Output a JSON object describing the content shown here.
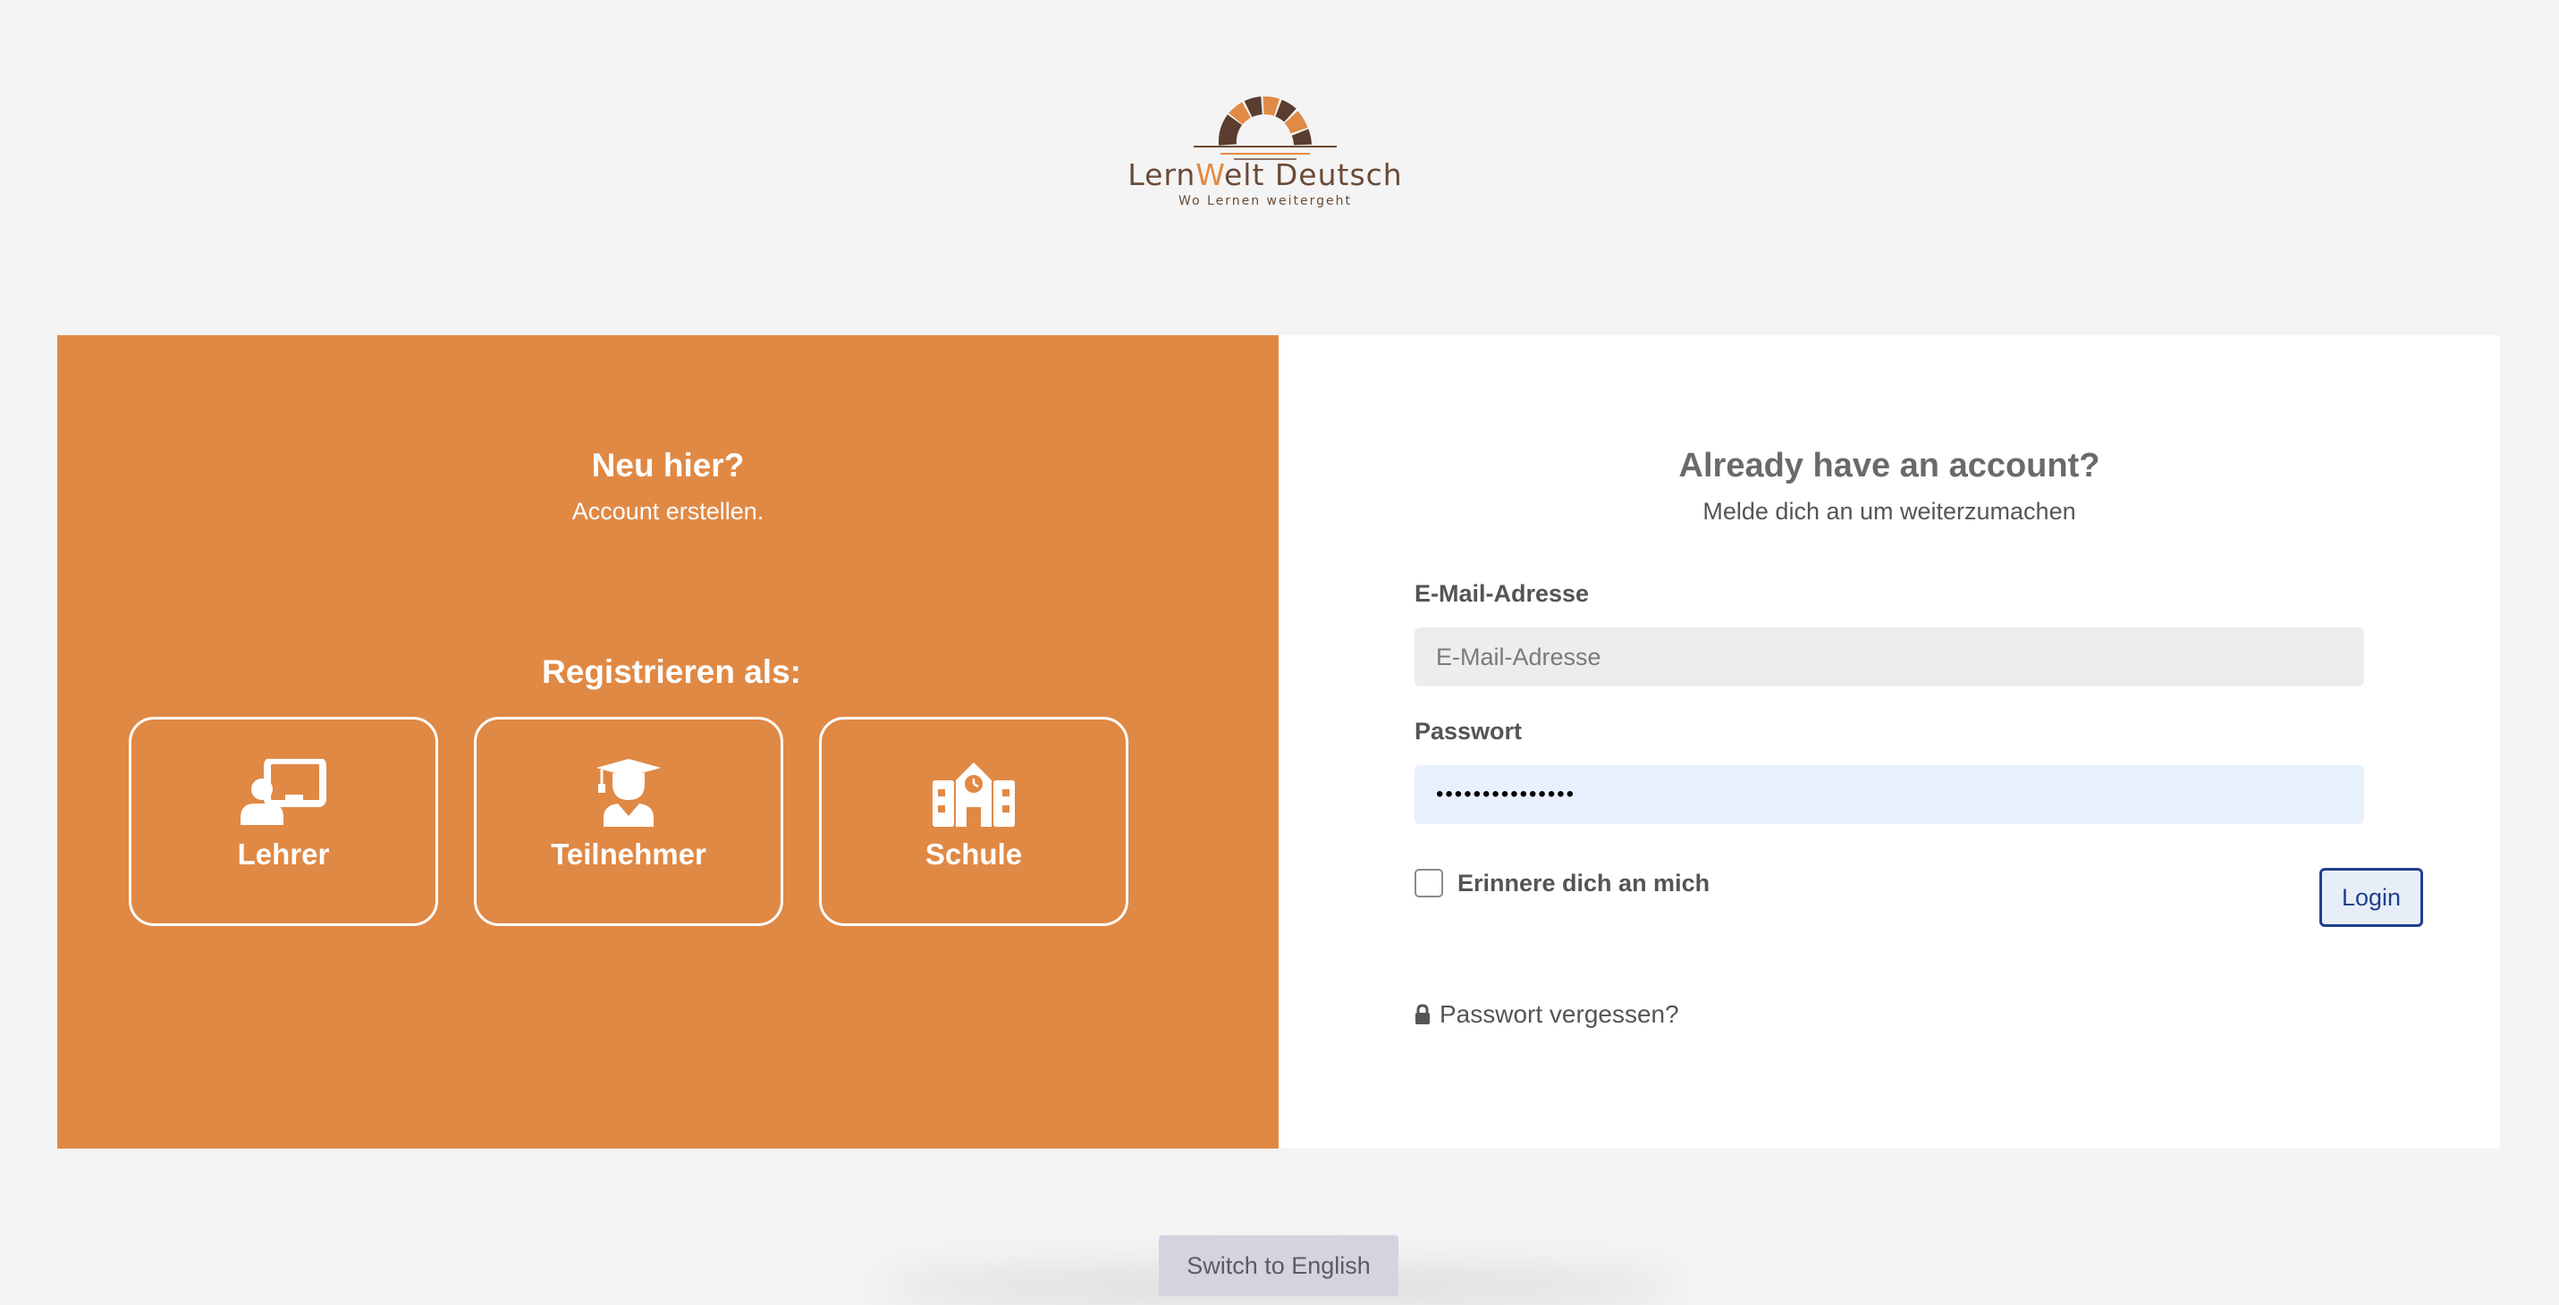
{
  "brand": {
    "name_part1": "Lern",
    "name_accent": "W",
    "name_part2": "elt Deutsch",
    "tagline": "Wo Lernen weitergeht",
    "colors": {
      "orange": "#e08945",
      "brown": "#6b4a36",
      "dark": "#5a3d30"
    }
  },
  "register_panel": {
    "title": "Neu hier?",
    "subtitle": "Account erstellen.",
    "register_as": "Registrieren als:",
    "background_color": "#e08945",
    "roles": [
      {
        "label": "Lehrer",
        "icon": "teacher-icon"
      },
      {
        "label": "Teilnehmer",
        "icon": "graduate-icon"
      },
      {
        "label": "Schule",
        "icon": "school-icon"
      }
    ]
  },
  "login_panel": {
    "title": "Already have an account?",
    "subtitle": "Melde dich an um weiterzumachen",
    "email": {
      "label": "E-Mail-Adresse",
      "placeholder": "E-Mail-Adresse",
      "value": ""
    },
    "password": {
      "label": "Passwort",
      "value": "•••••••••••••••"
    },
    "remember_me": {
      "label": "Erinnere dich an mich",
      "checked": false
    },
    "login_button": "Login",
    "forgot_password": "Passwort vergessen?",
    "forgot_icon": "lock-icon"
  },
  "language_switch": {
    "label": "Switch to English"
  }
}
